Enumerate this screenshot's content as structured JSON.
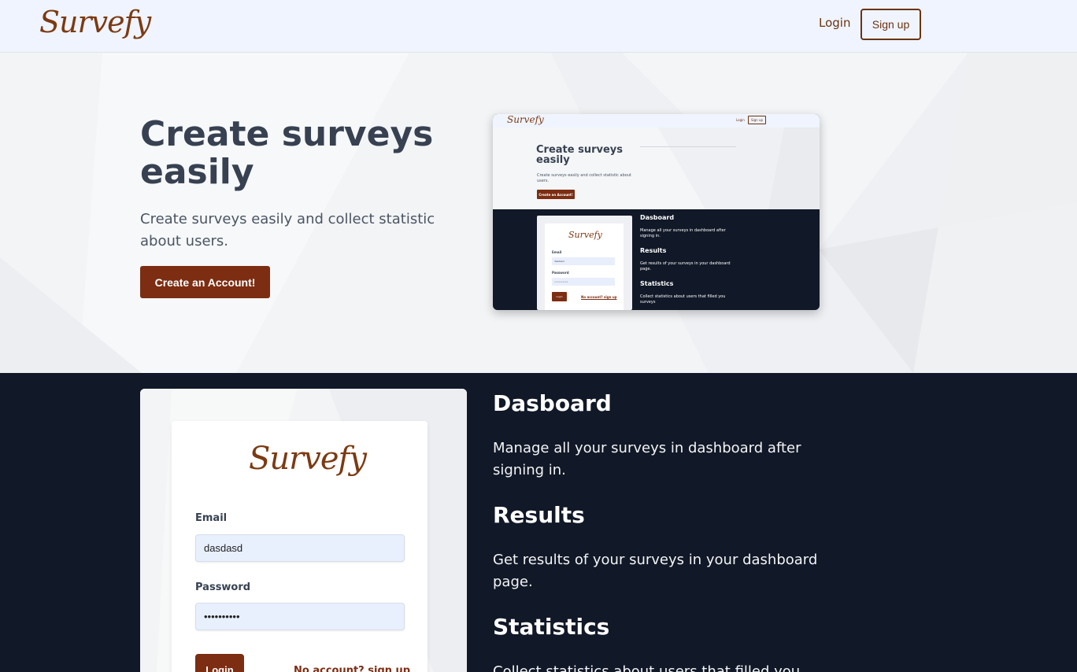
{
  "navbar": {
    "logo": "Survefy",
    "login_label": "Login",
    "signup_label": "Sign up"
  },
  "hero": {
    "title": "Create surveys easily",
    "subtitle": "Create surveys easily and collect statistic about users.",
    "cta_label": "Create an Account!"
  },
  "preview": {
    "logo": "Survefy",
    "login_label": "Login",
    "signup_label": "Sign up",
    "title": "Create surveys easily",
    "subtitle": "Create surveys easily and collect statistic about users.",
    "cta_label": "Create an Account!",
    "card_logo": "Survefy",
    "email_label": "Email",
    "email_value": "dasdasd",
    "password_label": "Password",
    "password_value": "••••••••••",
    "login_button": "Login",
    "no_account": "No account? sign up",
    "features": [
      {
        "title": "Dasboard",
        "text": "Manage all your surveys in dashboard after signing in."
      },
      {
        "title": "Results",
        "text": "Get results of your surveys in your dashboard page."
      },
      {
        "title": "Statistics",
        "text": "Collect statistics about users that filled you surveys"
      }
    ]
  },
  "login_form": {
    "logo": "Survefy",
    "email_label": "Email",
    "email_value": "dasdasd",
    "password_label": "Password",
    "password_value": "••••••••••",
    "login_button": "Login",
    "no_account_link": "No account? sign up"
  },
  "features": [
    {
      "title": "Dasboard",
      "text": "Manage all your surveys in dashboard after signing in."
    },
    {
      "title": "Results",
      "text": "Get results of your surveys in your dashboard page."
    },
    {
      "title": "Statistics",
      "text": "Collect statistics about users that filled you surveys"
    }
  ],
  "colors": {
    "brand": "#7c2d12",
    "navbar_bg": "#eff4fe",
    "dark_bg": "#111827",
    "hero_bg": "#e5e7eb"
  }
}
